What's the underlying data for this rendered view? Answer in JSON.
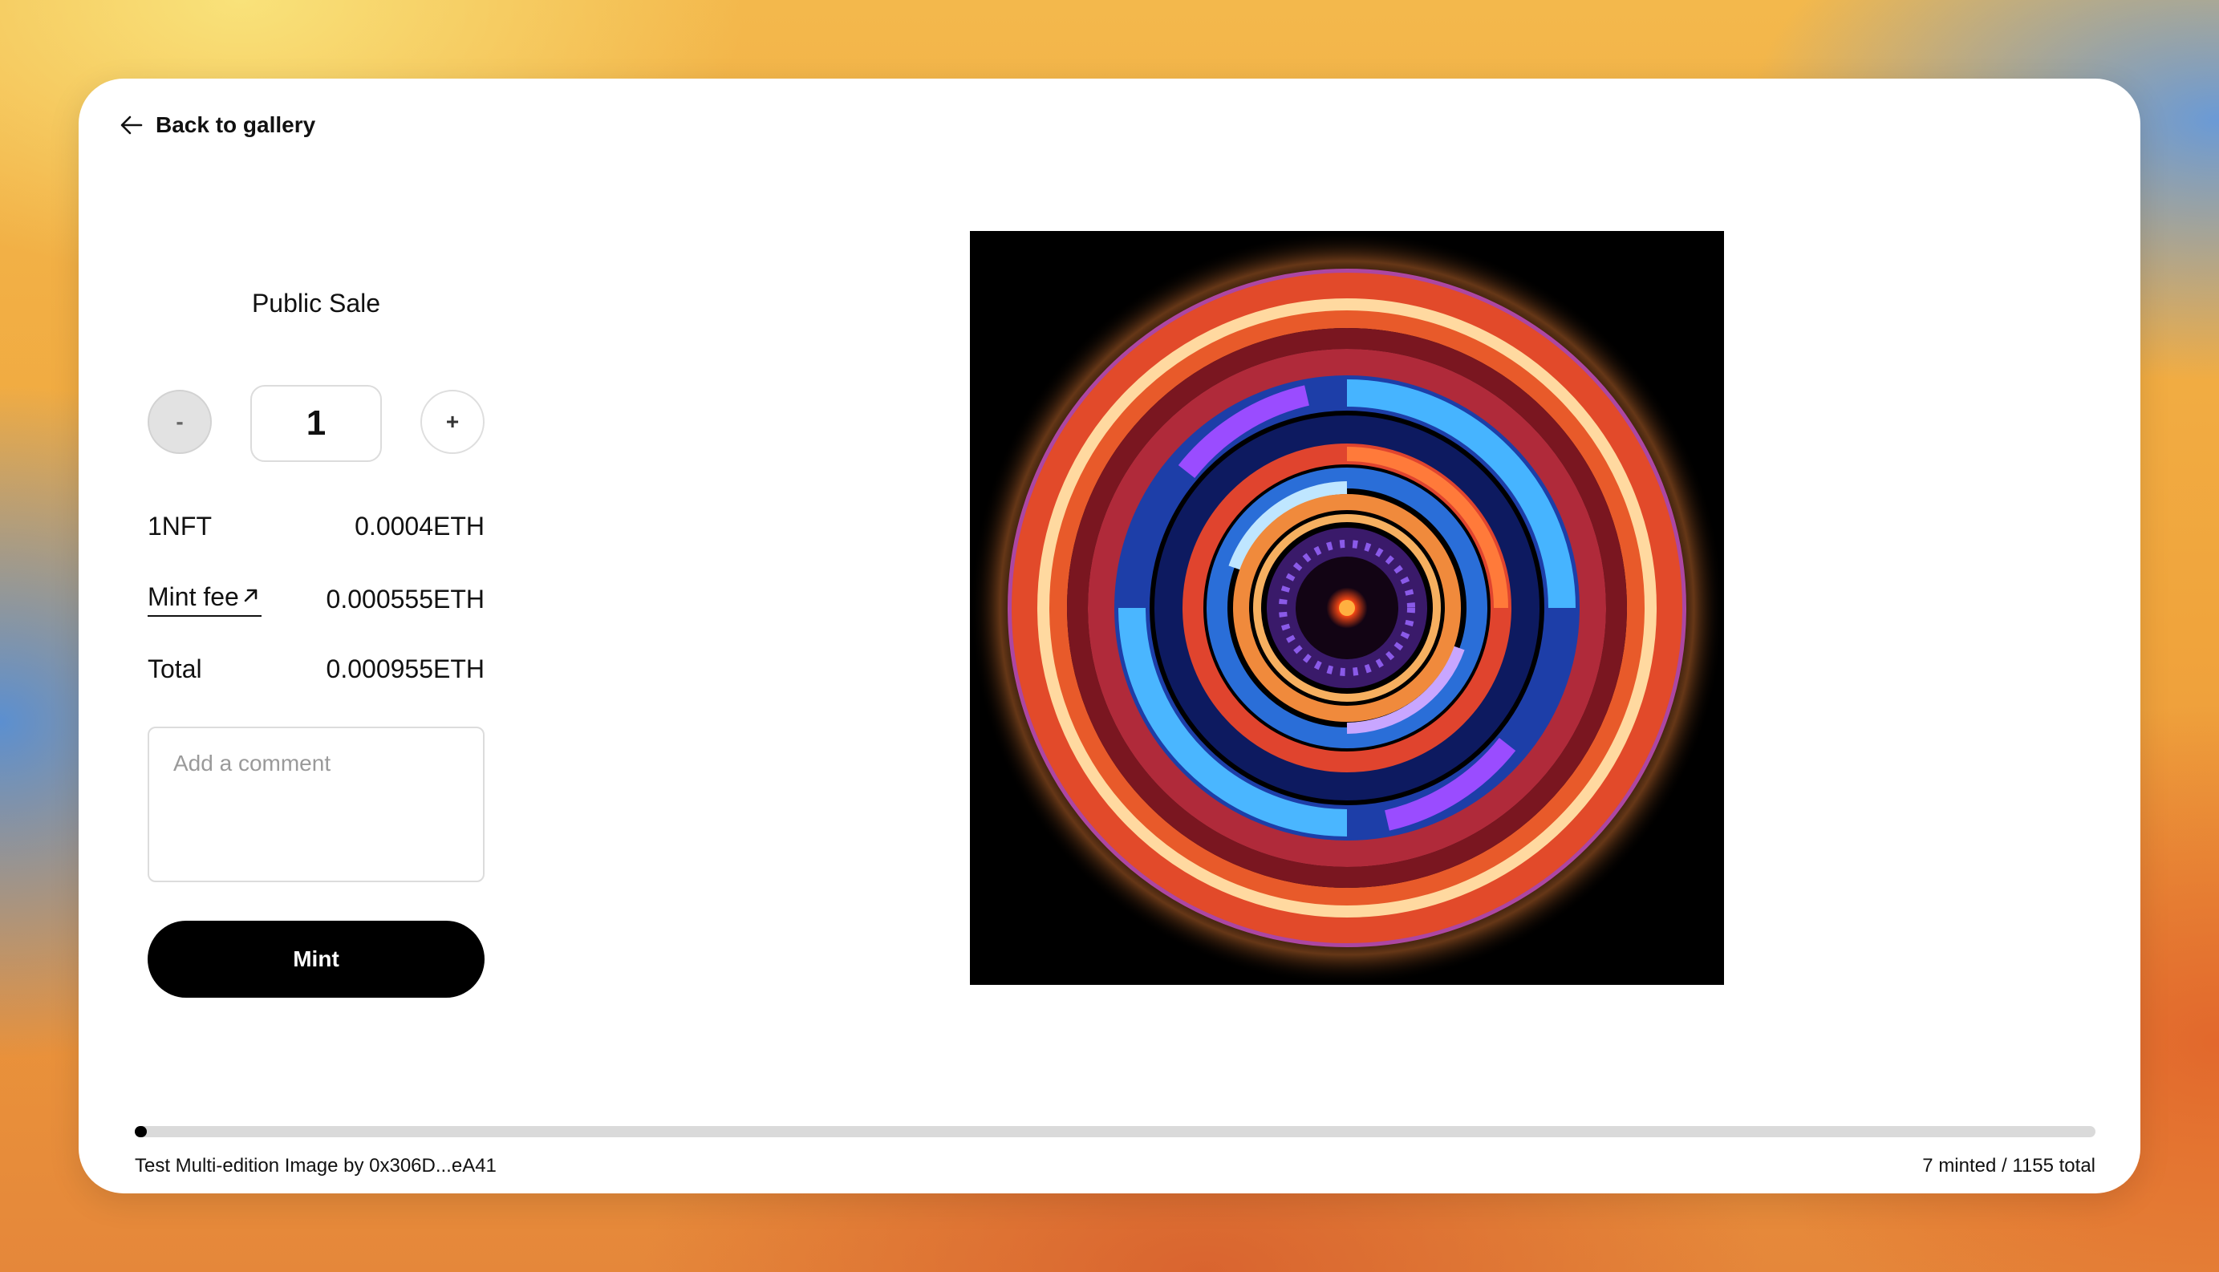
{
  "nav": {
    "back_label": "Back to gallery",
    "back_icon": "arrow-left-icon"
  },
  "sale": {
    "title": "Public Sale",
    "minus_label": "-",
    "plus_label": "+",
    "quantity": "1"
  },
  "pricing": {
    "nft_label": "1NFT",
    "nft_price": "0.0004ETH",
    "fee_label": "Mint fee",
    "fee_icon": "external-link-arrow-icon",
    "fee_price": "0.000555ETH",
    "total_label": "Total",
    "total_price": "0.000955ETH"
  },
  "comment": {
    "placeholder": "Add a comment",
    "value": ""
  },
  "mint": {
    "label": "Mint"
  },
  "footer": {
    "collection_line": "Test Multi-edition Image by 0x306D...eA41",
    "minted_line": "7 minted / 1155 total",
    "minted": 7,
    "total": 1155
  },
  "colors": {
    "button_bg": "#000000",
    "progress_track": "#dadada",
    "progress_fill": "#000000"
  }
}
